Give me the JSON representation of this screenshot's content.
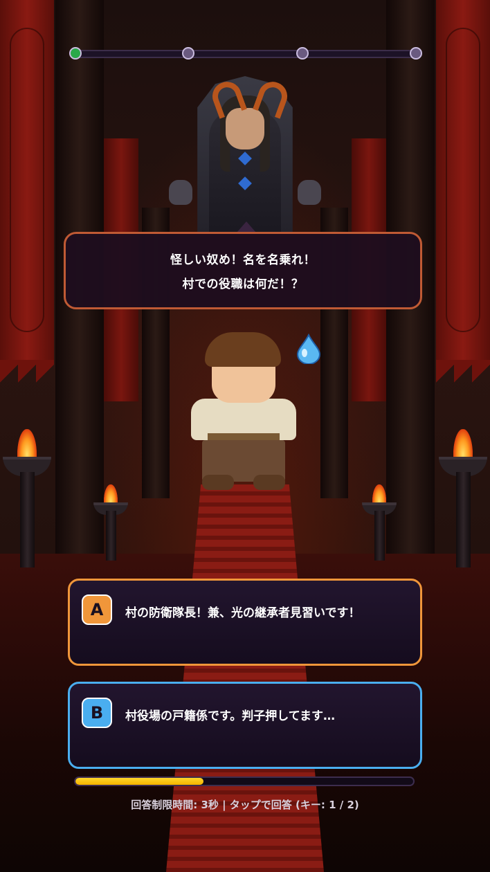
{
  "progress": {
    "current_step": 1,
    "total_steps": 4
  },
  "dialog": {
    "line1": "怪しい奴め！名を名乗れ！",
    "line2": "村での役職は何だ！？"
  },
  "answers": [
    {
      "key": "A",
      "text": "村の防衛隊長！兼、光の継承者見習いです！",
      "color": "#f0963a"
    },
    {
      "key": "B",
      "text": "村役場の戸籍係です。判子押してます…",
      "color": "#4aaef0"
    }
  ],
  "timer": {
    "remaining_fraction": 0.38,
    "label": "回答制限時間: 3秒 | タップで回答 (キー: 1 / 2)"
  }
}
